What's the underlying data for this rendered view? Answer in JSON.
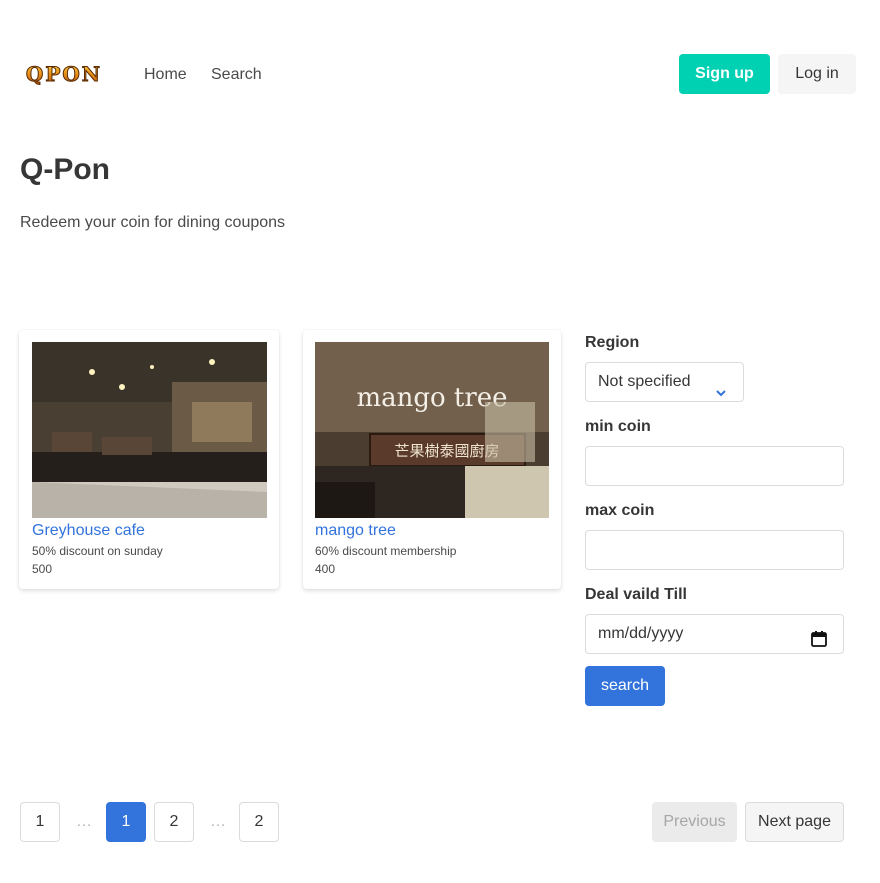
{
  "navbar": {
    "logo_text": "QPON",
    "links": {
      "home": "Home",
      "search": "Search"
    },
    "signup_label": "Sign up",
    "login_label": "Log in"
  },
  "hero": {
    "title": "Q-Pon",
    "subtitle": "Redeem your coin for dining coupons"
  },
  "coupons": [
    {
      "title": "Greyhouse cafe",
      "description": "50% discount on sunday",
      "coin": "500"
    },
    {
      "title": "mango tree",
      "description": "60% discount membership",
      "coin": "400"
    }
  ],
  "coupon_images": {
    "mango_sign": "mango tree",
    "mango_chinese_sign": "芒果樹泰國廚房"
  },
  "filters": {
    "region_label": "Region",
    "region_value": "Not specified",
    "min_coin_label": "min coin",
    "min_coin_value": "",
    "max_coin_label": "max coin",
    "max_coin_value": "",
    "deal_label": "Deal vaild Till",
    "deal_placeholder": "mm/dd/yyyy",
    "search_label": "search"
  },
  "pagination": {
    "first": "1",
    "ellipsis": "…",
    "current": "1",
    "next_num": "2",
    "last": "2",
    "previous_label": "Previous",
    "next_label": "Next page"
  },
  "colors": {
    "primary": "#00d1b2",
    "link": "#3273dc",
    "text": "#4a4a4a"
  }
}
